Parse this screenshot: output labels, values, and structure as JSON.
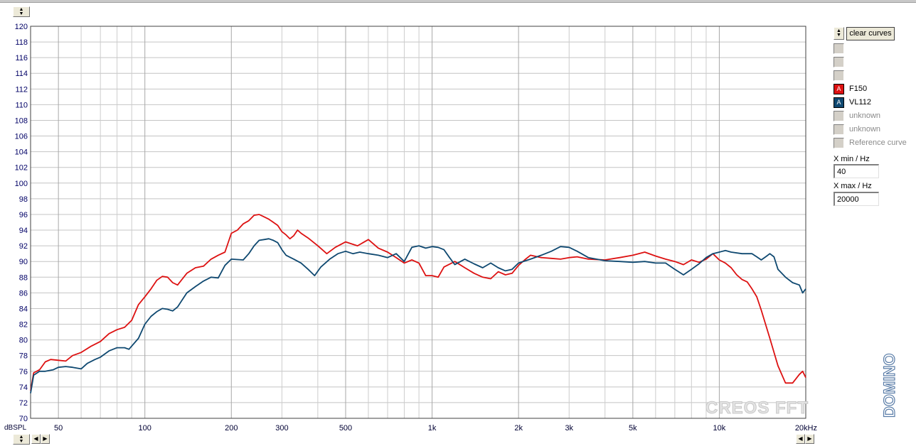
{
  "window": {
    "top_spinner": "spinner-up-down"
  },
  "chart_data": {
    "type": "line",
    "x_scale": "log",
    "xlim": [
      40,
      20000
    ],
    "ylim": [
      70,
      120
    ],
    "ylabel": "dBSPL",
    "grid": true,
    "y_ticks": [
      70,
      72,
      74,
      76,
      78,
      80,
      82,
      84,
      86,
      88,
      90,
      92,
      94,
      96,
      98,
      100,
      102,
      104,
      106,
      108,
      110,
      112,
      114,
      116,
      118,
      120
    ],
    "x_tick_labels": [
      {
        "x": 50,
        "label": "50"
      },
      {
        "x": 100,
        "label": "100"
      },
      {
        "x": 200,
        "label": "200"
      },
      {
        "x": 300,
        "label": "300"
      },
      {
        "x": 500,
        "label": "500"
      },
      {
        "x": 1000,
        "label": "1k"
      },
      {
        "x": 2000,
        "label": "2k"
      },
      {
        "x": 3000,
        "label": "3k"
      },
      {
        "x": 5000,
        "label": "5k"
      },
      {
        "x": 10000,
        "label": "10k"
      },
      {
        "x": 20000,
        "label": "20kHz"
      }
    ],
    "series": [
      {
        "name": "F150",
        "color": "#dd1111",
        "points": [
          [
            40,
            73.5
          ],
          [
            41,
            75.8
          ],
          [
            43,
            76.2
          ],
          [
            45,
            77.2
          ],
          [
            47,
            77.5
          ],
          [
            50,
            77.4
          ],
          [
            53,
            77.3
          ],
          [
            56,
            78
          ],
          [
            60,
            78.4
          ],
          [
            65,
            79.2
          ],
          [
            70,
            79.8
          ],
          [
            75,
            80.8
          ],
          [
            80,
            81.3
          ],
          [
            85,
            81.6
          ],
          [
            90,
            82.5
          ],
          [
            95,
            84.5
          ],
          [
            100,
            85.5
          ],
          [
            105,
            86.5
          ],
          [
            110,
            87.6
          ],
          [
            115,
            88.1
          ],
          [
            120,
            88
          ],
          [
            125,
            87.3
          ],
          [
            130,
            87
          ],
          [
            140,
            88.5
          ],
          [
            150,
            89.2
          ],
          [
            160,
            89.4
          ],
          [
            170,
            90.3
          ],
          [
            180,
            90.8
          ],
          [
            190,
            91.2
          ],
          [
            200,
            93.6
          ],
          [
            210,
            94
          ],
          [
            220,
            94.8
          ],
          [
            230,
            95.2
          ],
          [
            240,
            95.9
          ],
          [
            250,
            96
          ],
          [
            260,
            95.7
          ],
          [
            270,
            95.4
          ],
          [
            280,
            95
          ],
          [
            290,
            94.6
          ],
          [
            300,
            93.8
          ],
          [
            310,
            93.4
          ],
          [
            320,
            92.9
          ],
          [
            330,
            93.3
          ],
          [
            340,
            94
          ],
          [
            350,
            93.6
          ],
          [
            370,
            93
          ],
          [
            400,
            92
          ],
          [
            430,
            91
          ],
          [
            460,
            91.8
          ],
          [
            500,
            92.5
          ],
          [
            550,
            92
          ],
          [
            600,
            92.8
          ],
          [
            650,
            91.7
          ],
          [
            700,
            91.2
          ],
          [
            750,
            90.5
          ],
          [
            800,
            89.8
          ],
          [
            850,
            90.2
          ],
          [
            900,
            89.8
          ],
          [
            950,
            88.2
          ],
          [
            1000,
            88.2
          ],
          [
            1050,
            88
          ],
          [
            1100,
            89.3
          ],
          [
            1200,
            90
          ],
          [
            1300,
            89.2
          ],
          [
            1400,
            88.5
          ],
          [
            1500,
            88
          ],
          [
            1600,
            87.8
          ],
          [
            1700,
            88.7
          ],
          [
            1800,
            88.3
          ],
          [
            1900,
            88.5
          ],
          [
            2000,
            89.5
          ],
          [
            2100,
            90.2
          ],
          [
            2200,
            90.8
          ],
          [
            2400,
            90.5
          ],
          [
            2600,
            90.4
          ],
          [
            2800,
            90.3
          ],
          [
            3000,
            90.5
          ],
          [
            3200,
            90.6
          ],
          [
            3500,
            90.3
          ],
          [
            4000,
            90.2
          ],
          [
            4500,
            90.5
          ],
          [
            5000,
            90.8
          ],
          [
            5500,
            91.2
          ],
          [
            6000,
            90.7
          ],
          [
            6500,
            90.3
          ],
          [
            7000,
            90
          ],
          [
            7500,
            89.6
          ],
          [
            8000,
            90.2
          ],
          [
            8500,
            89.9
          ],
          [
            9000,
            90.3
          ],
          [
            9500,
            91
          ],
          [
            10000,
            90.2
          ],
          [
            10500,
            89.8
          ],
          [
            11000,
            89.2
          ],
          [
            11500,
            88.3
          ],
          [
            12000,
            87.7
          ],
          [
            12500,
            87.4
          ],
          [
            13000,
            86.5
          ],
          [
            13500,
            85.5
          ],
          [
            14000,
            83.8
          ],
          [
            15000,
            80.2
          ],
          [
            16000,
            76.7
          ],
          [
            17000,
            74.5
          ],
          [
            18000,
            74.5
          ],
          [
            19000,
            75.6
          ],
          [
            19500,
            76
          ],
          [
            20000,
            75.2
          ]
        ]
      },
      {
        "name": "VL112",
        "color": "#0e4870",
        "points": [
          [
            40,
            73.2
          ],
          [
            41,
            75.5
          ],
          [
            43,
            76
          ],
          [
            45,
            76
          ],
          [
            48,
            76.2
          ],
          [
            50,
            76.5
          ],
          [
            53,
            76.6
          ],
          [
            56,
            76.5
          ],
          [
            60,
            76.3
          ],
          [
            63,
            77
          ],
          [
            67,
            77.5
          ],
          [
            70,
            77.8
          ],
          [
            75,
            78.6
          ],
          [
            80,
            79
          ],
          [
            85,
            79
          ],
          [
            88,
            78.8
          ],
          [
            95,
            80.2
          ],
          [
            100,
            82
          ],
          [
            105,
            83
          ],
          [
            110,
            83.6
          ],
          [
            115,
            84
          ],
          [
            120,
            83.9
          ],
          [
            125,
            83.7
          ],
          [
            130,
            84.2
          ],
          [
            140,
            86
          ],
          [
            150,
            86.8
          ],
          [
            160,
            87.5
          ],
          [
            170,
            88
          ],
          [
            180,
            87.9
          ],
          [
            190,
            89.5
          ],
          [
            200,
            90.3
          ],
          [
            220,
            90.2
          ],
          [
            230,
            91
          ],
          [
            240,
            92
          ],
          [
            250,
            92.7
          ],
          [
            260,
            92.8
          ],
          [
            270,
            92.9
          ],
          [
            280,
            92.7
          ],
          [
            290,
            92.4
          ],
          [
            300,
            91.5
          ],
          [
            310,
            90.8
          ],
          [
            330,
            90.3
          ],
          [
            350,
            89.8
          ],
          [
            370,
            89
          ],
          [
            390,
            88.2
          ],
          [
            410,
            89.3
          ],
          [
            440,
            90.3
          ],
          [
            470,
            91
          ],
          [
            500,
            91.3
          ],
          [
            530,
            91
          ],
          [
            560,
            91.2
          ],
          [
            600,
            91
          ],
          [
            650,
            90.8
          ],
          [
            700,
            90.5
          ],
          [
            750,
            91
          ],
          [
            800,
            90
          ],
          [
            850,
            91.8
          ],
          [
            900,
            92
          ],
          [
            950,
            91.7
          ],
          [
            1000,
            91.9
          ],
          [
            1050,
            91.8
          ],
          [
            1100,
            91.5
          ],
          [
            1150,
            90.5
          ],
          [
            1200,
            89.6
          ],
          [
            1300,
            90.3
          ],
          [
            1400,
            89.7
          ],
          [
            1500,
            89.2
          ],
          [
            1600,
            89.8
          ],
          [
            1700,
            89.2
          ],
          [
            1800,
            88.8
          ],
          [
            1900,
            89
          ],
          [
            2000,
            89.8
          ],
          [
            2200,
            90.3
          ],
          [
            2400,
            90.8
          ],
          [
            2600,
            91.3
          ],
          [
            2800,
            91.9
          ],
          [
            3000,
            91.8
          ],
          [
            3200,
            91.3
          ],
          [
            3500,
            90.5
          ],
          [
            4000,
            90.1
          ],
          [
            4500,
            90
          ],
          [
            5000,
            89.9
          ],
          [
            5500,
            90
          ],
          [
            6000,
            89.8
          ],
          [
            6500,
            89.8
          ],
          [
            7000,
            89
          ],
          [
            7500,
            88.3
          ],
          [
            8000,
            89
          ],
          [
            8500,
            89.7
          ],
          [
            9000,
            90.5
          ],
          [
            9500,
            91
          ],
          [
            10000,
            91.2
          ],
          [
            10500,
            91.4
          ],
          [
            11000,
            91.2
          ],
          [
            12000,
            91
          ],
          [
            13000,
            91
          ],
          [
            13500,
            90.6
          ],
          [
            14000,
            90.2
          ],
          [
            14500,
            90.6
          ],
          [
            15000,
            91
          ],
          [
            15500,
            90.6
          ],
          [
            16000,
            89
          ],
          [
            17000,
            88
          ],
          [
            18000,
            87.3
          ],
          [
            19000,
            87
          ],
          [
            19500,
            86
          ],
          [
            20000,
            86.5
          ]
        ]
      }
    ]
  },
  "panel": {
    "clear_label": "clear curves",
    "slots": [
      {
        "badge": "",
        "label": "",
        "active": false
      },
      {
        "badge": "",
        "label": "",
        "active": false
      },
      {
        "badge": "",
        "label": "",
        "active": false
      },
      {
        "badge": "A",
        "label": "F150",
        "active": true,
        "color": "#dd1111"
      },
      {
        "badge": "A",
        "label": "VL112",
        "active": true,
        "color": "#0e4870"
      },
      {
        "badge": "",
        "label": "unknown",
        "active": false
      },
      {
        "badge": "",
        "label": "unknown",
        "active": false
      },
      {
        "badge": "",
        "label": "Reference curve",
        "active": false
      }
    ],
    "xmin_label": "X min / Hz",
    "xmin_value": "40",
    "xmax_label": "X max / Hz",
    "xmax_value": "20000"
  },
  "branding": {
    "watermark": "CREOS FFT",
    "vertical_logo": "DOMINO"
  }
}
